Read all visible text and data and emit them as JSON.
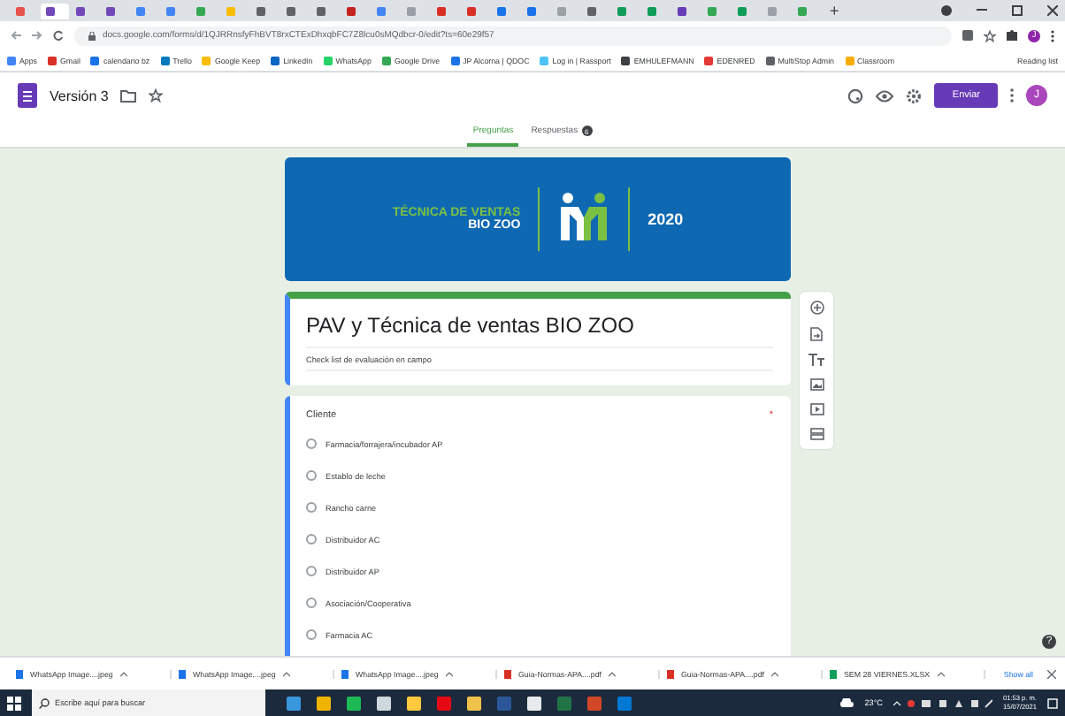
{
  "browser": {
    "tabs": [
      {
        "color": "#e5534b",
        "selected": false
      },
      {
        "color": "#7248b9",
        "selected": true
      },
      {
        "color": "#7248b9",
        "selected": false
      },
      {
        "color": "#7248b9",
        "selected": false
      },
      {
        "color": "#4285f4",
        "selected": false
      },
      {
        "color": "#4285f4",
        "selected": false
      },
      {
        "color": "#34a853",
        "selected": false
      },
      {
        "color": "#fbbc04",
        "selected": false
      },
      {
        "color": "#5f6368",
        "selected": false
      },
      {
        "color": "#5f6368",
        "selected": false
      },
      {
        "color": "#5f6368",
        "selected": false
      },
      {
        "color": "#c5221f",
        "selected": false
      },
      {
        "color": "#4285f4",
        "selected": false
      },
      {
        "color": "#9aa0a6",
        "selected": false
      },
      {
        "color": "#d93025",
        "selected": false
      },
      {
        "color": "#d93025",
        "selected": false
      },
      {
        "color": "#1a73e8",
        "selected": false
      },
      {
        "color": "#1a73e8",
        "selected": false
      },
      {
        "color": "#9aa0a6",
        "selected": false
      },
      {
        "color": "#5f6368",
        "selected": false
      },
      {
        "color": "#0f9d58",
        "selected": false
      },
      {
        "color": "#0f9d58",
        "selected": false
      },
      {
        "color": "#673ab7",
        "selected": false
      },
      {
        "color": "#34a853",
        "selected": false
      },
      {
        "color": "#0f9d58",
        "selected": false
      },
      {
        "color": "#9aa0a6",
        "selected": false
      },
      {
        "color": "#34a853",
        "selected": false
      }
    ],
    "new_tab": "+",
    "url": "docs.google.com/forms/d/1QJRRnsfyFhBVT8rxCTExDhxqbFC7Z8lcu0sMQdbcr-0/edit?ts=60e29f57",
    "profile": "J",
    "bookmarks": [
      {
        "label": "Apps",
        "color": "#4285f4"
      },
      {
        "label": "Gmail",
        "color": "#d93025"
      },
      {
        "label": "calendario bz",
        "color": "#1a73e8"
      },
      {
        "label": "Trello",
        "color": "#0079bf"
      },
      {
        "label": "Google Keep",
        "color": "#fbbc04"
      },
      {
        "label": "LinkedIn",
        "color": "#0a66c2"
      },
      {
        "label": "WhatsApp",
        "color": "#25d366"
      },
      {
        "label": "Google Drive",
        "color": "#34a853"
      },
      {
        "label": "JP Alcorna | QDOC",
        "color": "#1a73e8"
      },
      {
        "label": "Log in | Rassport",
        "color": "#4fc3f7"
      },
      {
        "label": "EMHULEFMANN",
        "color": "#3c4043"
      },
      {
        "label": "EDENRED",
        "color": "#e53935"
      },
      {
        "label": "MultiStop Admin",
        "color": "#5f6368"
      },
      {
        "label": "Classroom",
        "color": "#f9ab00"
      }
    ],
    "reading_list": "Reading list"
  },
  "form": {
    "title": "Versión 3",
    "send": "Enviar",
    "avatar": "J",
    "tabs": [
      {
        "label": "Preguntas",
        "selected": true
      },
      {
        "label": "Respuestas",
        "badge": "6",
        "selected": false
      }
    ],
    "banner": {
      "line_1": "TÉCNICA DE VENTAS",
      "line_2": "BIO ZOO",
      "year": "2020"
    },
    "heading": "PAV y Técnica de ventas BIO ZOO",
    "description": "Check list de evaluación en campo",
    "question": {
      "title": "Cliente",
      "required_mark": "*",
      "options": [
        {
          "label": "Farmacia/forrajera/incubador AP",
          "selected": false
        },
        {
          "label": "Establo de leche",
          "selected": false
        },
        {
          "label": "Rancho carne",
          "selected": false
        },
        {
          "label": "Distribuidor AC",
          "selected": false
        },
        {
          "label": "Distribuidor AP",
          "selected": false
        },
        {
          "label": "Asociación/Cooperativa",
          "selected": false
        },
        {
          "label": "Farmacia AC",
          "selected": false
        }
      ]
    },
    "help": "?"
  },
  "downloads": {
    "items": [
      {
        "name": "WhatsApp Image....jpeg",
        "kind": "image"
      },
      {
        "name": "WhatsApp Image....jpeg",
        "kind": "image"
      },
      {
        "name": "WhatsApp Image....jpeg",
        "kind": "image"
      },
      {
        "name": "Guia-Normas-APA....pdf",
        "kind": "pdf"
      },
      {
        "name": "Guia-Normas-APA....pdf",
        "kind": "pdf"
      },
      {
        "name": "SEM 28 VIERNES.XLSX",
        "kind": "sheet"
      }
    ],
    "show_all": "Show all"
  },
  "taskbar": {
    "search_placeholder": "Escribe aquí para buscar",
    "apps": [
      {
        "color": "#3a96dd"
      },
      {
        "color": "#f0b400"
      },
      {
        "color": "#1db954"
      },
      {
        "color": "#cfd8dc"
      },
      {
        "color": "#ffc83d"
      },
      {
        "color": "#e50914"
      },
      {
        "color": "#f0c14b"
      },
      {
        "color": "#2b579a"
      },
      {
        "color": "#e8eaed"
      },
      {
        "color": "#217346"
      },
      {
        "color": "#d24726"
      },
      {
        "color": "#0078d4"
      }
    ],
    "weather": "23°C",
    "time": "01:53 p. m.",
    "date": "15/07/2021"
  }
}
